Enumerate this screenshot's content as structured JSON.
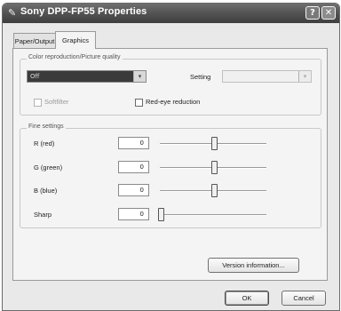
{
  "window": {
    "title": "Sony DPP-FP55 Properties",
    "help_glyph": "?",
    "close_glyph": "✕"
  },
  "tabs": [
    {
      "label": "Paper/Output"
    },
    {
      "label": "Graphics"
    }
  ],
  "color_group": {
    "legend": "Color reproduction/Picture quality",
    "mode_value": "Off",
    "setting_label": "Setting",
    "setting_value": "",
    "softfilter_label": "Softfilter",
    "redeye_label": "Red-eye reduction"
  },
  "fine_group": {
    "legend": "Fine settings",
    "rows": [
      {
        "label": "R (red)",
        "value": "0",
        "level": 0.5
      },
      {
        "label": "G (green)",
        "value": "0",
        "level": 0.5
      },
      {
        "label": "B (blue)",
        "value": "0",
        "level": 0.5
      },
      {
        "label": "Sharp",
        "value": "0",
        "level": 0
      }
    ]
  },
  "buttons": {
    "version": "Version information...",
    "ok": "OK",
    "cancel": "Cancel"
  },
  "icons": {
    "app": "printer-icon",
    "dropdown": "▾",
    "spin": "⇕"
  }
}
